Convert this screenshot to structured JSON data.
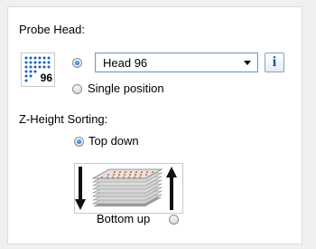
{
  "probe_head": {
    "section_label": "Probe Head:",
    "icon": {
      "name": "probe-head-96-grid-icon",
      "count_label": "96"
    },
    "options": {
      "head": {
        "selected": true
      },
      "single": {
        "label": "Single position",
        "selected": false
      }
    },
    "head_select": {
      "value": "Head 96"
    },
    "info_button": {
      "icon": "info-icon",
      "glyph": "i"
    }
  },
  "z_height_sorting": {
    "section_label": "Z-Height Sorting:",
    "options": {
      "top_down": {
        "label": "Top down",
        "selected": true
      },
      "bottom_up": {
        "label": "Bottom up",
        "selected": false
      }
    },
    "illustration": {
      "name": "plate-stack-icon",
      "left_arrow": "down-arrow-icon",
      "right_arrow": "up-arrow-icon"
    }
  }
}
